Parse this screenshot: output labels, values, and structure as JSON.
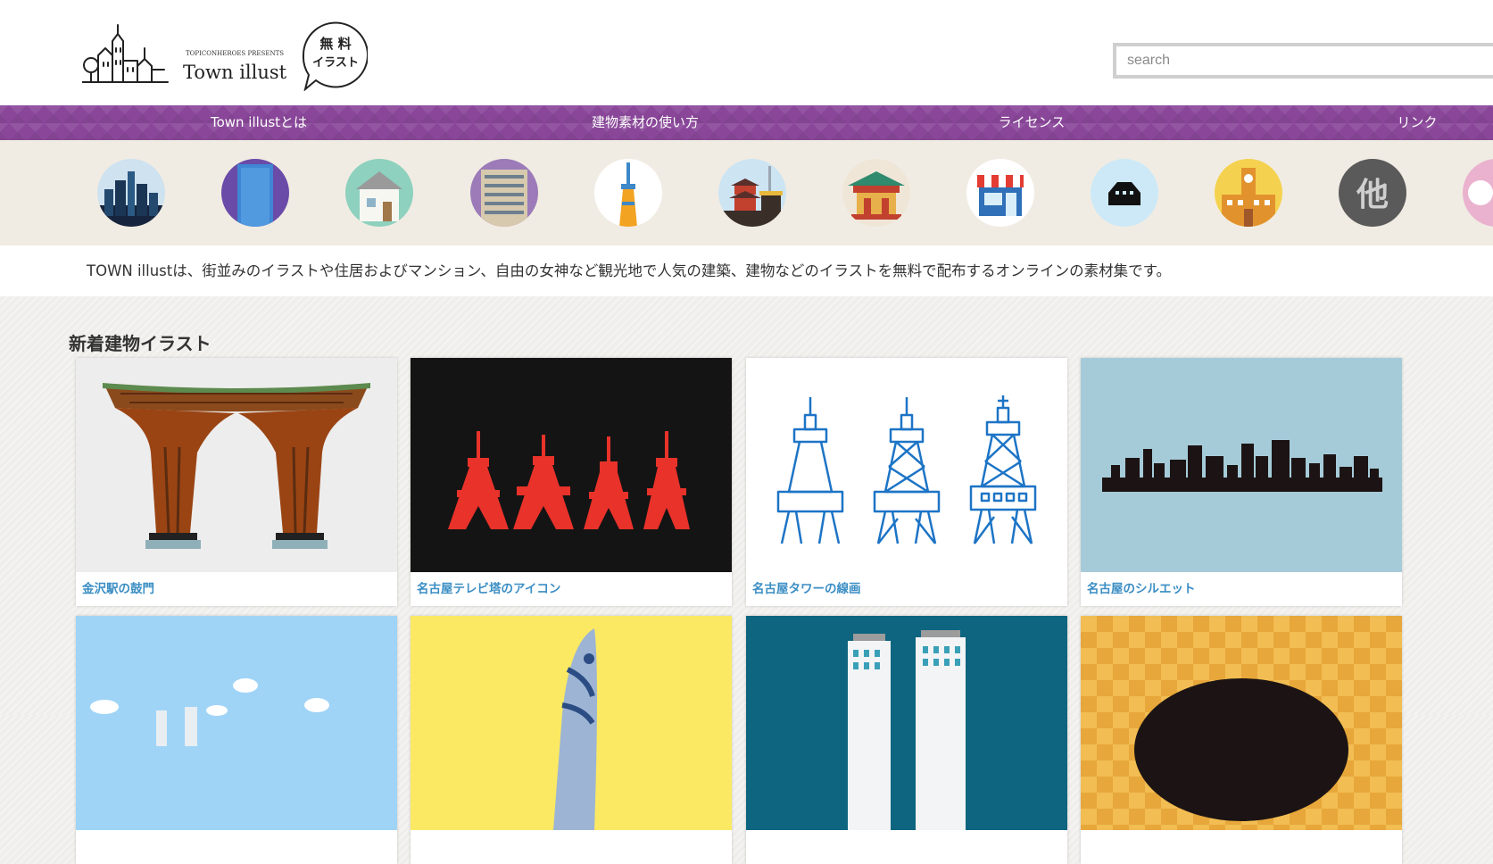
{
  "header": {
    "logo": {
      "presents": "TOPICONHEROES PRESENTS",
      "name": "Town illust",
      "badge_line1": "無 料",
      "badge_line2": "イラスト"
    },
    "search": {
      "placeholder": "search",
      "value": ""
    }
  },
  "nav": {
    "items": [
      {
        "label": "Town illustとは"
      },
      {
        "label": "建物素材の使い方"
      },
      {
        "label": "ライセンス"
      },
      {
        "label": "リンク"
      }
    ]
  },
  "categories": {
    "items": [
      {
        "icon": "city-skyline-icon",
        "bg": "#16243e"
      },
      {
        "icon": "office-building-icon",
        "bg": "#6a4ba8"
      },
      {
        "icon": "house-icon",
        "bg": "#8dd1be"
      },
      {
        "icon": "apartment-icon",
        "bg": "#9c7bb8"
      },
      {
        "icon": "tower-icon",
        "bg": "#ffffff"
      },
      {
        "icon": "temple-icon",
        "bg": "#cde4f3"
      },
      {
        "icon": "shrine-icon",
        "bg": "#efe6d8"
      },
      {
        "icon": "shop-icon",
        "bg": "#ffffff"
      },
      {
        "icon": "castle-icon",
        "bg": "#cde9f7"
      },
      {
        "icon": "school-icon",
        "bg": "#f4d250"
      },
      {
        "icon": "other-icon",
        "bg": "#5a5a5a",
        "label": "他"
      },
      {
        "icon": "more-icon",
        "bg": "#eab2cf"
      }
    ]
  },
  "description": "TOWN illustは、街並みのイラストや住居およびマンション、自由の女神など観光地で人気の建築、建物などのイラストを無料で配布するオンラインの素材集です。",
  "section": {
    "title": "新着建物イラスト",
    "cards": [
      {
        "caption": "金沢駅の鼓門",
        "image": "kanazawa-gate-illustration"
      },
      {
        "caption": "名古屋テレビ塔のアイコン",
        "image": "nagoya-tv-tower-icons"
      },
      {
        "caption": "名古屋タワーの線画",
        "image": "nagoya-tower-line-art"
      },
      {
        "caption": "名古屋のシルエット",
        "image": "nagoya-silhouette"
      },
      {
        "caption": "",
        "image": "skyline-sky-illustration"
      },
      {
        "caption": "",
        "image": "spiral-tower-illustration"
      },
      {
        "caption": "",
        "image": "twin-towers-illustration"
      },
      {
        "caption": "",
        "image": "gold-checker-illustration"
      }
    ]
  }
}
